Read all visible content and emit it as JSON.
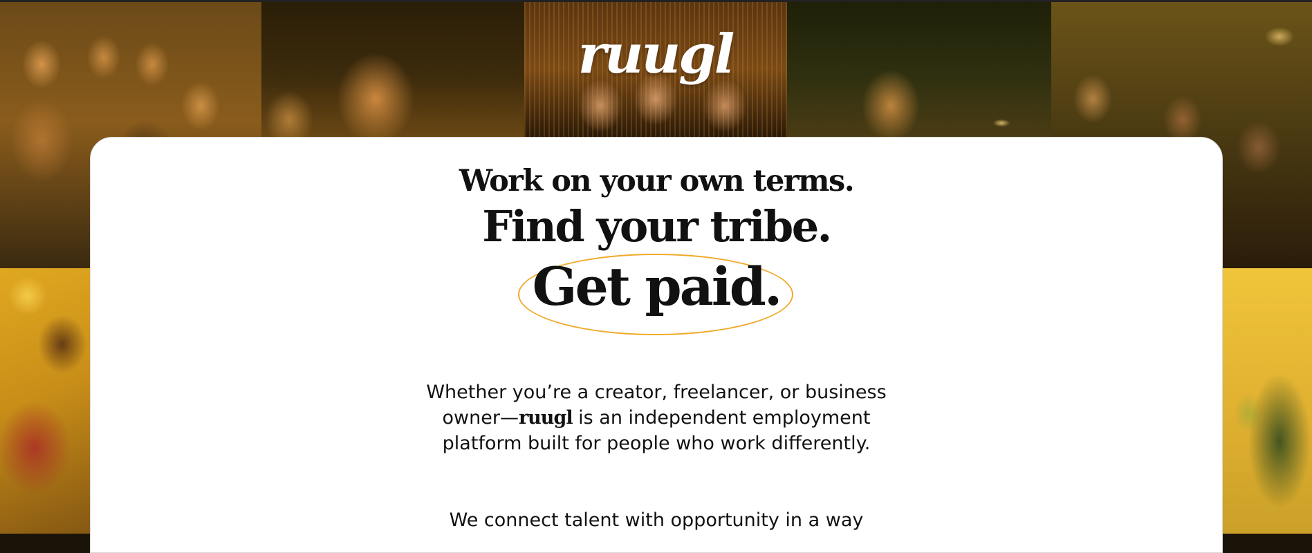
{
  "brand": {
    "logo_text": "ruugl"
  },
  "hero": {
    "line_1": "Work on your own terms.",
    "line_2": "Find your tribe.",
    "line_3": "Get paid."
  },
  "intro": {
    "paragraph_1_before": "Whether you’re a creator, freelancer, or business owner—",
    "paragraph_1_brand": "ruugl",
    "paragraph_1_after": " is an independent employment platform built for people who work differently.",
    "paragraph_2": "We connect talent with opportunity in a way"
  },
  "colors": {
    "accent_oval": "#f0aa2a",
    "card_background": "#ffffff",
    "text": "#111111",
    "photo_tint": "amber"
  }
}
